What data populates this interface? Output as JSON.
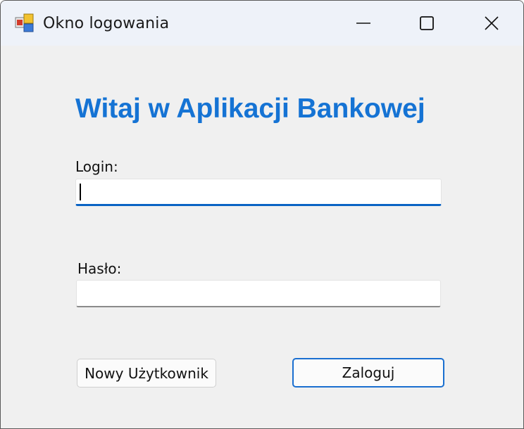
{
  "window": {
    "title": "Okno logowania",
    "icon": "windows-forms-app-icon",
    "controls": [
      "minimize-icon",
      "maximize-icon",
      "close-icon"
    ]
  },
  "form": {
    "heading": "Witaj w Aplikacji Bankowej",
    "login_label": "Login:",
    "login_value": "",
    "password_label": "Hasło:",
    "password_value": "",
    "new_user_button": "Nowy Użytkownik",
    "login_button": "Zaloguj"
  },
  "colors": {
    "heading": "#1573d4",
    "focus_accent": "#0a63c4",
    "background": "#f0f0f0",
    "titlebar": "#eef2f9"
  }
}
